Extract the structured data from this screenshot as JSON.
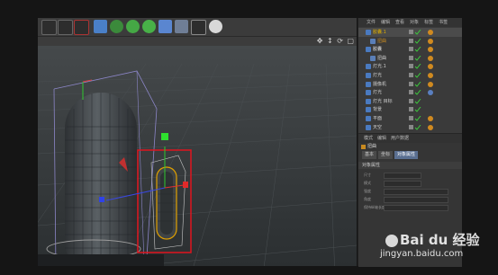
{
  "menubar": {
    "items": [
      "文件",
      "编辑",
      "查看",
      "对象",
      "标签",
      "书签"
    ]
  },
  "viewport": {
    "header_icons": "✥ ↕ ⟳ ▢"
  },
  "objects": [
    {
      "name": "胶囊.1",
      "color": "#e0b000",
      "indent": 0,
      "icon": "capsule-icon",
      "selected": true
    },
    {
      "name": "扭曲",
      "color": "#c88a20",
      "indent": 1,
      "icon": "deformer-icon",
      "selected": false
    },
    {
      "name": "胶囊",
      "color": "#e0e0e0",
      "indent": 0,
      "icon": "capsule-icon",
      "selected": false
    },
    {
      "name": "扭曲",
      "color": "#d0d0d0",
      "indent": 1,
      "icon": "deformer-icon",
      "selected": false
    },
    {
      "name": "灯光.1",
      "color": "#d0d0d0",
      "indent": 0,
      "icon": "light-icon",
      "selected": false
    },
    {
      "name": "灯光",
      "color": "#d0d0d0",
      "indent": 0,
      "icon": "light-icon",
      "selected": false
    },
    {
      "name": "摄像机",
      "color": "#d0d0d0",
      "indent": 0,
      "icon": "camera-icon",
      "selected": false
    },
    {
      "name": "灯光",
      "color": "#d0d0d0",
      "indent": 0,
      "icon": "light-icon",
      "selected": false
    },
    {
      "name": "灯光 目标",
      "color": "#d0d0d0",
      "indent": 0,
      "icon": "target-icon",
      "selected": false
    },
    {
      "name": "背景",
      "color": "#d0d0d0",
      "indent": 0,
      "icon": "background-icon",
      "selected": false
    },
    {
      "name": "平面",
      "color": "#d0d0d0",
      "indent": 0,
      "icon": "plane-icon",
      "selected": false
    },
    {
      "name": "天空",
      "color": "#d0d0d0",
      "indent": 0,
      "icon": "sky-icon",
      "selected": false
    }
  ],
  "attributes": {
    "menu": [
      "模式",
      "编辑",
      "用户数据"
    ],
    "title": "扭曲",
    "tabs": [
      "基本",
      "坐标",
      "对象属性",
      "衰减选项"
    ],
    "section": "对象属性",
    "props": [
      "尺寸",
      "模式",
      "强度",
      "角度",
      "保持纵轴长度"
    ]
  },
  "watermark": {
    "logo": "Bai du 经验",
    "url": "jingyan.baidu.com"
  },
  "colors": {
    "selection_box": "#e0141e",
    "accent_yellow": "#f0c000",
    "panel_bg": "#3a3a3a",
    "viewport_bg": "#2c3032"
  }
}
